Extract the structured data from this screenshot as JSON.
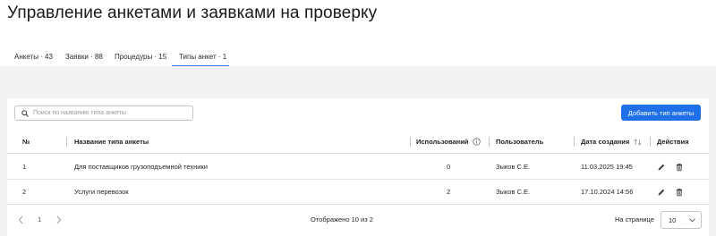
{
  "page": {
    "title": "Управление анкетами и заявками на проверку"
  },
  "tabs": [
    {
      "label": "Анкеты · 43"
    },
    {
      "label": "Заявки · 88"
    },
    {
      "label": "Процедуры · 15"
    },
    {
      "label": "Типы анкет · 1",
      "active": true
    }
  ],
  "search": {
    "placeholder": "Поиск по названию типа анкеты",
    "value": ""
  },
  "toolbar": {
    "add_label": "Добавить тип анкеты"
  },
  "table": {
    "headers": {
      "num": "№",
      "name": "Название типа анкеты",
      "usage": "Использований",
      "user": "Пользователь",
      "date": "Дата создания",
      "actions": "Действия"
    },
    "rows": [
      {
        "num": "1",
        "name": "Для поставщиков грузоподъемной техники",
        "usage": "0",
        "user": "Зыков С.Е.",
        "date": "11.03.2025 19:45"
      },
      {
        "num": "2",
        "name": "Услуги перевозок",
        "usage": "2",
        "user": "Зыков С.Е.",
        "date": "17.10.2024 14:56"
      }
    ]
  },
  "pagination": {
    "page": "1",
    "shown": "Отображено 10 из 2",
    "per_page_label": "На странице",
    "per_page": "10"
  },
  "colors": {
    "accent": "#1e6fe8",
    "tab_underline": "#3a78e8",
    "background": "#f2f2f2"
  }
}
